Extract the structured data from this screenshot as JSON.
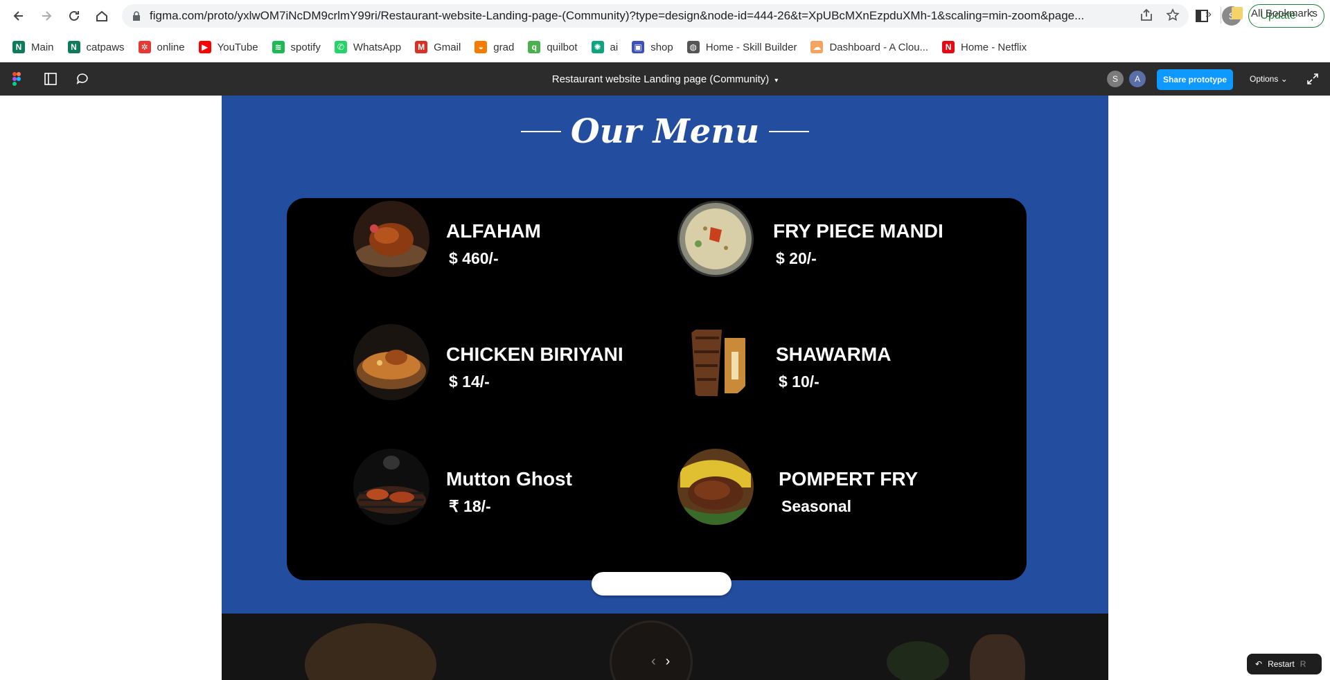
{
  "browser": {
    "url": "figma.com/proto/yxlwOM7iNcDM9crlmY99ri/Restaurant-website-Landing-page-(Community)?type=design&node-id=444-26&t=XpUBcMXnEzpduXMh-1&scaling=min-zoom&page...",
    "profile_initial": "S",
    "update_label": "Update"
  },
  "bookmarks": {
    "items": [
      {
        "label": "Main",
        "icon": "notion-icon",
        "color": "#0f7b5b",
        "glyph": "N"
      },
      {
        "label": "catpaws",
        "icon": "notion-icon",
        "color": "#0f7b5b",
        "glyph": "N"
      },
      {
        "label": "online",
        "icon": "online-icon",
        "color": "#e53935",
        "glyph": "✲"
      },
      {
        "label": "YouTube",
        "icon": "youtube-icon",
        "color": "#ff0000",
        "glyph": "▶"
      },
      {
        "label": "spotify",
        "icon": "spotify-icon",
        "color": "#1db954",
        "glyph": "≋"
      },
      {
        "label": "WhatsApp",
        "icon": "whatsapp-icon",
        "color": "#25d366",
        "glyph": "✆"
      },
      {
        "label": "Gmail",
        "icon": "gmail-icon",
        "color": "#d93025",
        "glyph": "M"
      },
      {
        "label": "grad",
        "icon": "grad-icon",
        "color": "#f57c00",
        "glyph": "◒"
      },
      {
        "label": "quilbot",
        "icon": "quillbot-icon",
        "color": "#4caf50",
        "glyph": "q"
      },
      {
        "label": "ai",
        "icon": "openai-icon",
        "color": "#10a37f",
        "glyph": "✺"
      },
      {
        "label": "shop",
        "icon": "shop-icon",
        "color": "#3f51b5",
        "glyph": "▣"
      },
      {
        "label": "Home - Skill Builder",
        "icon": "globe-icon",
        "color": "#555555",
        "glyph": "◍"
      },
      {
        "label": "Dashboard - A Clou...",
        "icon": "cloud-icon",
        "color": "#f4a460",
        "glyph": "☁"
      },
      {
        "label": "Home - Netflix",
        "icon": "netflix-icon",
        "color": "#e50914",
        "glyph": "N"
      }
    ],
    "more": "»",
    "all_bookmarks": "All Bookmarks"
  },
  "figma": {
    "file_title": "Restaurant website Landing page (Community)",
    "avatars": [
      "S",
      "A"
    ],
    "share_label": "Share prototype",
    "options_label": "Options",
    "restart_label": "Restart",
    "restart_key": "R"
  },
  "page": {
    "section_title": "Our Menu",
    "menu_items": [
      {
        "name": "ALFAHAM",
        "price": "$ 460/-",
        "dish": "grilled-chicken"
      },
      {
        "name": "FRY PIECE MANDI",
        "price": "$ 20/-",
        "dish": "mandi-rice"
      },
      {
        "name": "CHICKEN BIRIYANI",
        "price": "$ 14/-",
        "dish": "biryani"
      },
      {
        "name": "SHAWARMA",
        "price": "$ 10/-",
        "dish": "shawarma"
      },
      {
        "name": "Mutton Ghost",
        "price": "₹ 18/-",
        "dish": "grill"
      },
      {
        "name": "POMPERT FRY",
        "price": "Seasonal",
        "dish": "fish-fry"
      }
    ]
  },
  "colors": {
    "section_blue": "#234ea0",
    "card_black": "#000000",
    "figma_toolbar": "#2c2c2c",
    "share_blue": "#0d99ff"
  }
}
